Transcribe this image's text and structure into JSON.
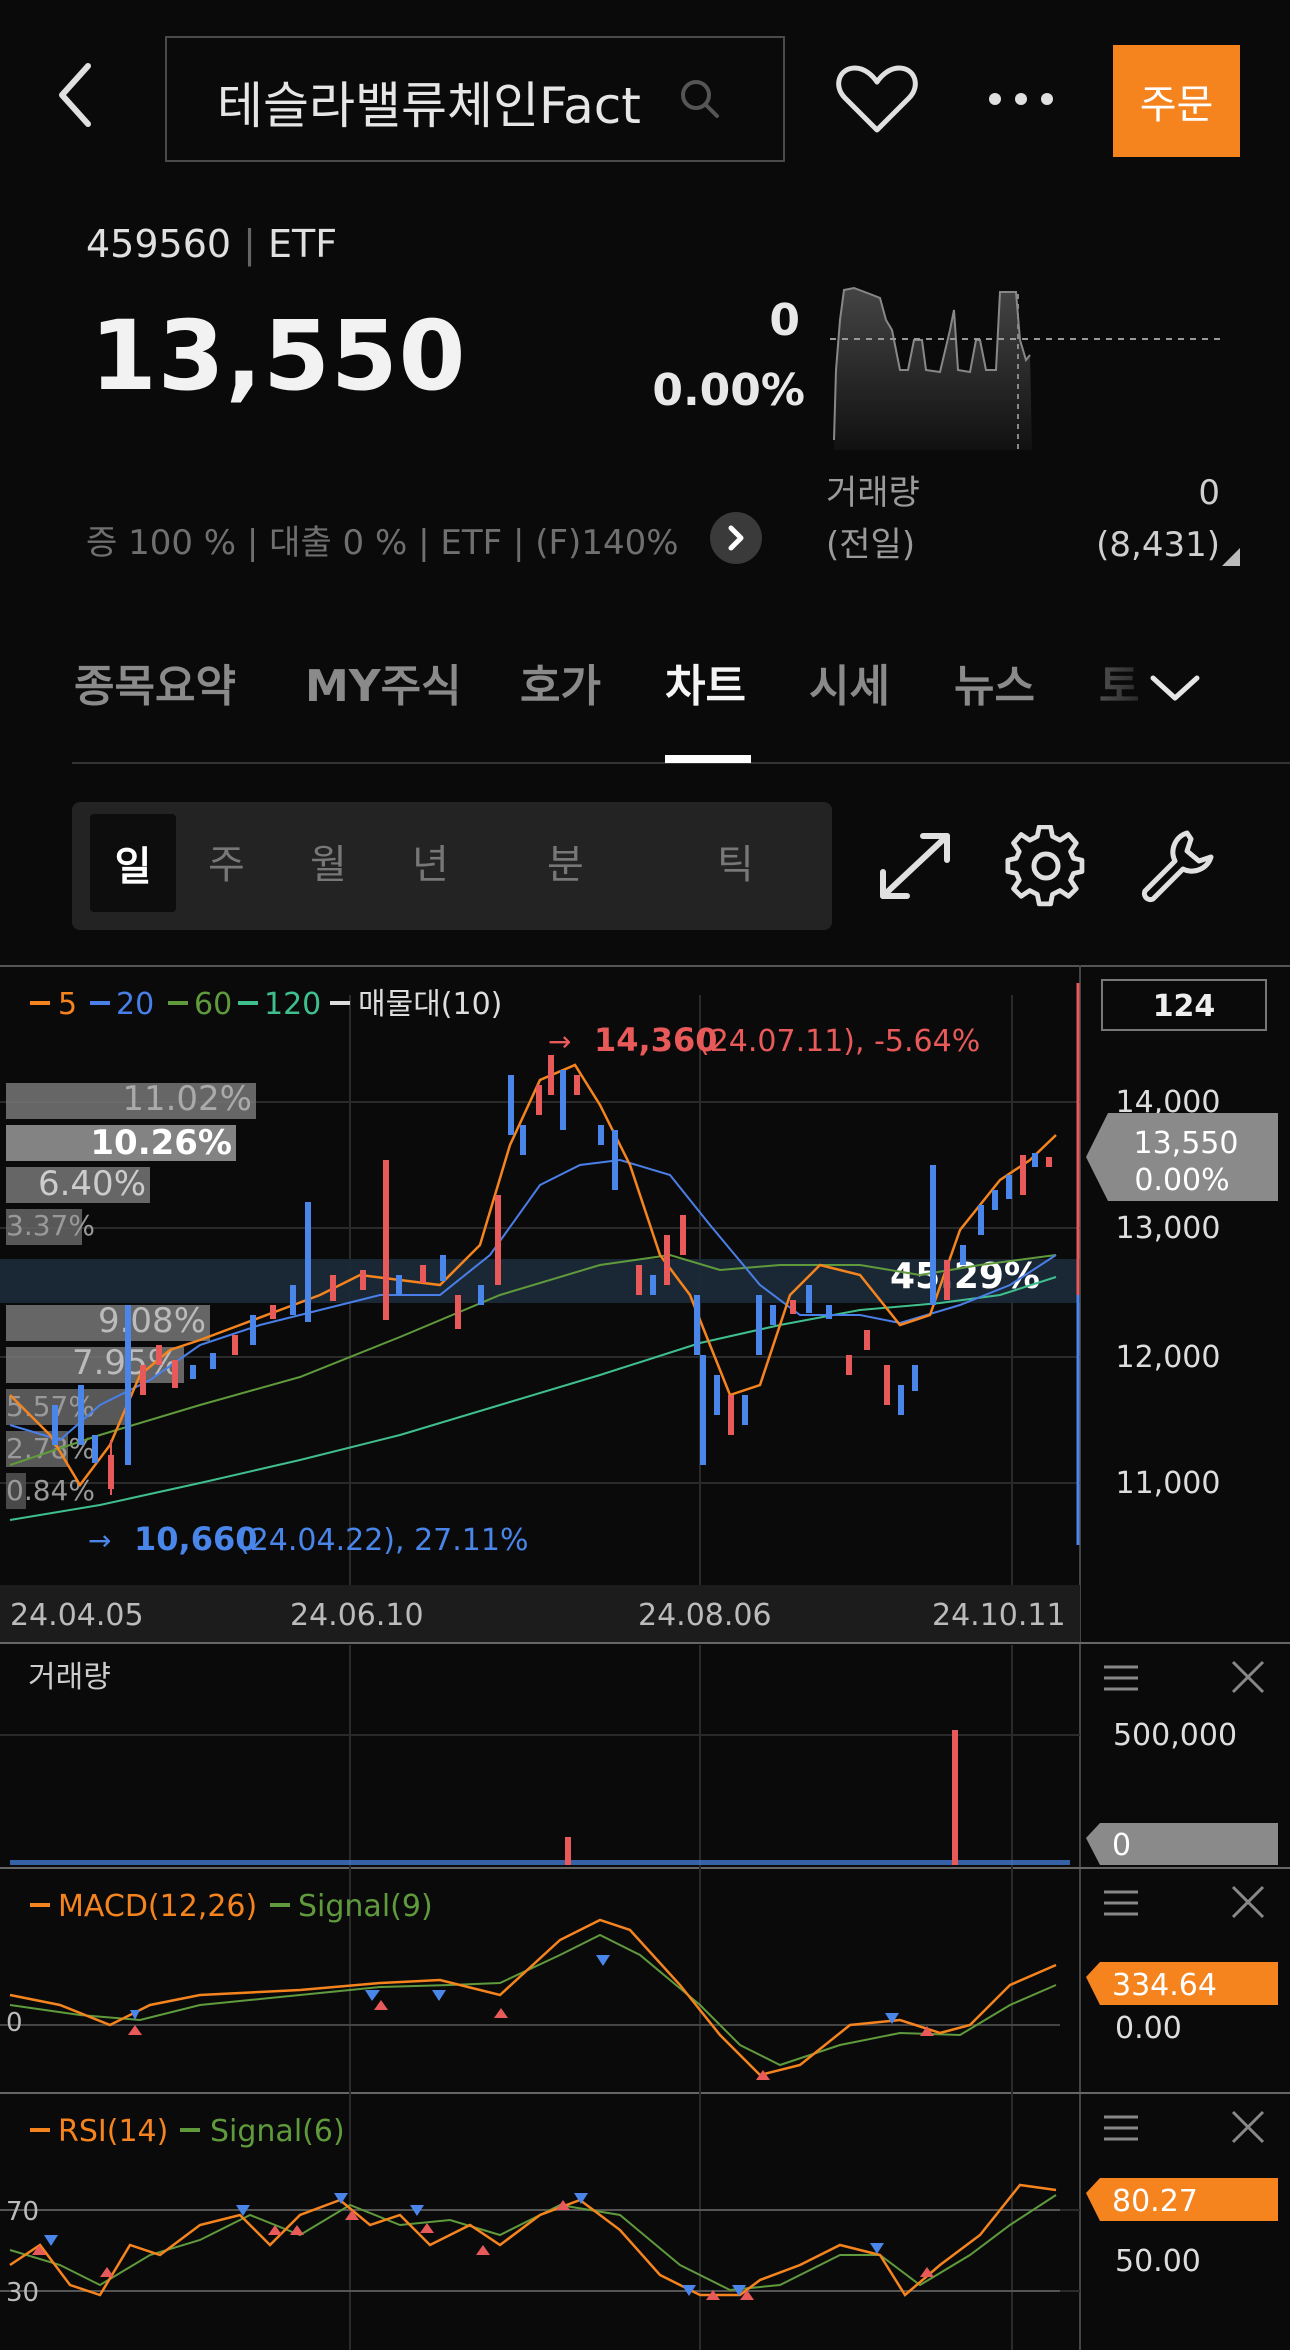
{
  "header": {
    "search_text": "테슬라밸류체인Fact",
    "order_label": "주문"
  },
  "stock": {
    "code": "459560",
    "type": "ETF",
    "price": "13,550",
    "change": "0",
    "change_pct": "0.00%",
    "volume_label": "거래량",
    "volume_prev_label": "(전일)",
    "volume_today": "0",
    "volume_prev": "(8,431)",
    "info_line": "증 100 % | 대출 0 % | ETF | (F)140%"
  },
  "tabs": [
    {
      "label": "종목요약"
    },
    {
      "label": "MY주식"
    },
    {
      "label": "호가"
    },
    {
      "label": "차트"
    },
    {
      "label": "시세"
    },
    {
      "label": "뉴스"
    },
    {
      "label": "토"
    }
  ],
  "periods": [
    "일",
    "주",
    "월",
    "년",
    "분",
    "틱"
  ],
  "chart": {
    "legend": {
      "ma5": "5",
      "ma20": "20",
      "ma60": "60",
      "ma120": "120",
      "vp": "매물대(10)"
    },
    "colors": {
      "ma5": "#f5841f",
      "ma20": "#4a7fe8",
      "ma60": "#5f9a3c",
      "ma120": "#3fbf8e",
      "up": "#e85a5a",
      "down": "#4a86ea"
    },
    "count_badge": "124",
    "high_label": "14,360",
    "high_detail": "(24.07.11), -5.64%",
    "low_label": "10,660",
    "low_detail": "(24.04.22), 27.11%",
    "cur_price": "13,550",
    "cur_pct": "0.00%",
    "y_ticks": [
      "14,000",
      "13,000",
      "12,000",
      "11,000"
    ],
    "x_ticks": [
      "24.04.05",
      "24.06.10",
      "24.08.06",
      "24.10.11"
    ],
    "vp_pcts": [
      "11.02%",
      "10.26%",
      "6.40%",
      "3.37%",
      "9.08%",
      "7.95%",
      "5.57%",
      "2.78%",
      "0.84%",
      "45.29%"
    ]
  },
  "volume_panel": {
    "title": "거래량",
    "tick": "500,000",
    "current": "0"
  },
  "macd_panel": {
    "title": "MACD(12,26)",
    "signal": "Signal(9)",
    "current": "334.64",
    "zero_label": "0",
    "tick": "0.00"
  },
  "rsi_panel": {
    "title": "RSI(14)",
    "signal": "Signal(6)",
    "current": "80.27",
    "tick70": "70",
    "tick30": "30",
    "tick": "50.00"
  }
}
